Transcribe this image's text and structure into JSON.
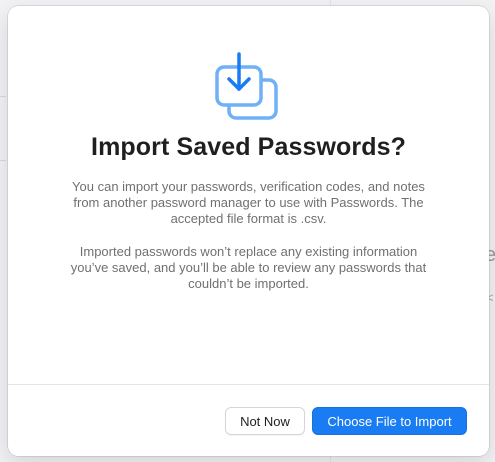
{
  "dialog": {
    "icon": "import-download-icon",
    "title": "Import Saved Passwords?",
    "paragraph1": "You can import your passwords, verification codes, and notes from another password manager to use with Passwords. The accepted file format is .csv.",
    "paragraph2": "Imported passwords won’t replace any existing information you’ve saved, and you’ll be able to review any passwords that couldn’t be imported.",
    "buttons": {
      "not_now": "Not Now",
      "choose_file": "Choose File to Import"
    }
  },
  "background": {
    "partial_text": "e",
    "partial_small": "<"
  },
  "colors": {
    "accent": "#1a7cf2",
    "icon": "#6fb0f7",
    "title": "#1f1f21",
    "body_text": "#707074"
  }
}
